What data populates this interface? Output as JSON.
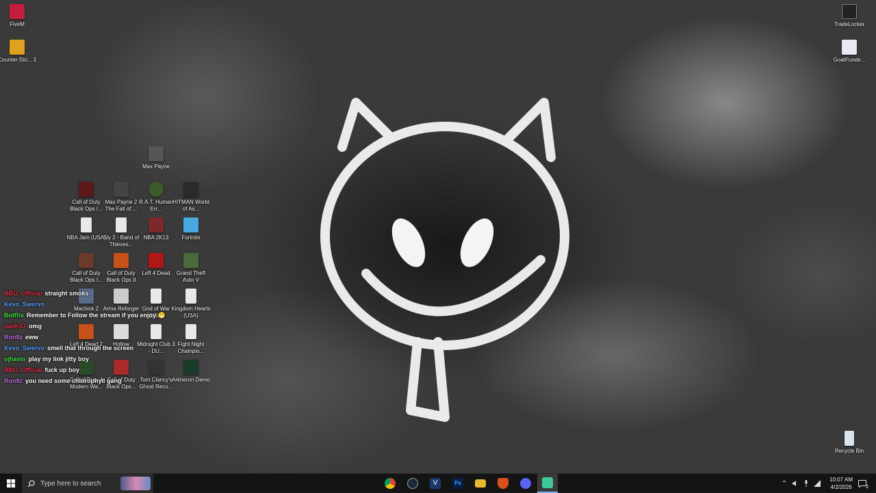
{
  "desktop": {
    "icons": [
      {
        "label": "FiveM",
        "color": "#c21d3c",
        "icon": "fivem-icon"
      },
      {
        "label": "Counter-Stri... 2",
        "color": "#e0a020",
        "icon": "counter-strike-icon"
      },
      {
        "label": "TradeLocker",
        "color": "#222222",
        "icon": "tradelocker-icon"
      },
      {
        "label": "GoatFunde...",
        "color": "#e8e8f0",
        "icon": "goatfunded-icon"
      },
      {
        "label": "Max Payne",
        "color": "#555555",
        "icon": "max-payne-icon"
      },
      {
        "label": "Call of Duty Black Ops I...",
        "color": "#5a1a1a",
        "icon": "cod-black-ops-icon"
      },
      {
        "label": "Max Payne 2 The Fall of ...",
        "color": "#444444",
        "icon": "max-payne-2-icon"
      },
      {
        "label": "R.A.T. Human Err...",
        "color": "#3d5a2a",
        "icon": "rat-icon"
      },
      {
        "label": "HITMAN World of As...",
        "color": "#2a2a2a",
        "icon": "hitman-icon"
      },
      {
        "label": "NBA Jam (USA)",
        "color": "#e8e8e8",
        "icon": "file-icon"
      },
      {
        "label": "Sly 2 - Band of Thieves...",
        "color": "#e8e8e8",
        "icon": "file-icon"
      },
      {
        "label": "NBA 2K13",
        "color": "#7a2a2a",
        "icon": "nba2k13-icon"
      },
      {
        "label": "Fortnite",
        "color": "#4aa8e0",
        "icon": "fortnite-icon"
      },
      {
        "label": "Call of Duty Black Ops I...",
        "color": "#6a3a2a",
        "icon": "cod-black-ops-icon"
      },
      {
        "label": "Call of Duty Black Ops II",
        "color": "#c8501a",
        "icon": "cod-black-ops-2-icon"
      },
      {
        "label": "Left 4 Dead",
        "color": "#b01818",
        "icon": "left-4-dead-icon"
      },
      {
        "label": "Grand Theft Auto V",
        "color": "#4a6a3a",
        "icon": "gta-v-icon"
      },
      {
        "label": "Machick 2",
        "color": "#5a6a8a",
        "icon": "game-icon"
      },
      {
        "label": "Arma Reforger",
        "color": "#cccccc",
        "icon": "arma-icon"
      },
      {
        "label": "God of War (USA)",
        "color": "#e8e8e8",
        "icon": "file-icon"
      },
      {
        "label": "Kingdom Hearts (USA)",
        "color": "#e8e8e8",
        "icon": "file-icon"
      },
      {
        "label": "Left 4 Dead 2",
        "color": "#c8501a",
        "icon": "left-4-dead-2-icon"
      },
      {
        "label": "Hollow",
        "color": "#dddddd",
        "icon": "hollow-icon"
      },
      {
        "label": "Midnight Club 3 - DU...",
        "color": "#e8e8e8",
        "icon": "file-icon"
      },
      {
        "label": "Fight Night Champio...",
        "color": "#e8e8e8",
        "icon": "file-icon"
      },
      {
        "label": "Call of Duty 4 Modern Wa...",
        "color": "#2a4a2a",
        "icon": "cod4-icon"
      },
      {
        "label": "Call of Duty Black Ops...",
        "color": "#aa2a2a",
        "icon": "cod-black-ops-icon"
      },
      {
        "label": "Tom Clancy's Ghost Reco...",
        "color": "#333333",
        "icon": "ghost-recon-icon"
      },
      {
        "label": "Arkheron Demo",
        "color": "#1a3a2a",
        "icon": "arkheron-icon"
      },
      {
        "label": "Recycle Bin",
        "color": "#d8e4ee",
        "icon": "recycle-bin-icon"
      }
    ]
  },
  "chat": [
    {
      "user": "BBG_Officiai",
      "color": "#e0344a",
      "message": "straight smoks"
    },
    {
      "user": "Kevo_Swervo",
      "color": "#5aa0ff",
      "message": ""
    },
    {
      "user": "BotRix",
      "color": "#45e045",
      "message": "Remember to Follow the stream if you enjoy 😁"
    },
    {
      "user": "daiiK47",
      "color": "#e0344a",
      "message": "omg"
    },
    {
      "user": "Ron8z",
      "color": "#c070e0",
      "message": "eww"
    },
    {
      "user": "Kevo_Swervo",
      "color": "#5aa0ff",
      "message": "smell that through the screen"
    },
    {
      "user": "ojhavin",
      "color": "#45e045",
      "message": "play my link jitty boy"
    },
    {
      "user": "BBG_Officiai",
      "color": "#e0344a",
      "message": "fuck up boy"
    },
    {
      "user": "Ron8z",
      "color": "#c070e0",
      "message": "you need some chlorophyll gang"
    }
  ],
  "taskbar": {
    "search_placeholder": "Type here to search",
    "apps": [
      {
        "icon": "chrome-icon",
        "color": "#e8a020"
      },
      {
        "icon": "steam-icon",
        "color": "#1b2838"
      },
      {
        "icon": "visual-studio-code-icon",
        "color": "#1a3a6a"
      },
      {
        "icon": "photoshop-icon",
        "color": "#0a1e44"
      },
      {
        "icon": "file-explorer-icon",
        "color": "#e8b830"
      },
      {
        "icon": "brave-icon",
        "color": "#d8501a"
      },
      {
        "icon": "discord-icon",
        "color": "#5865f2"
      },
      {
        "icon": "active-app-icon",
        "color": "#3ec99a"
      }
    ],
    "time": "10:07 AM",
    "date": "4/2/2026",
    "notification_count": "2"
  }
}
